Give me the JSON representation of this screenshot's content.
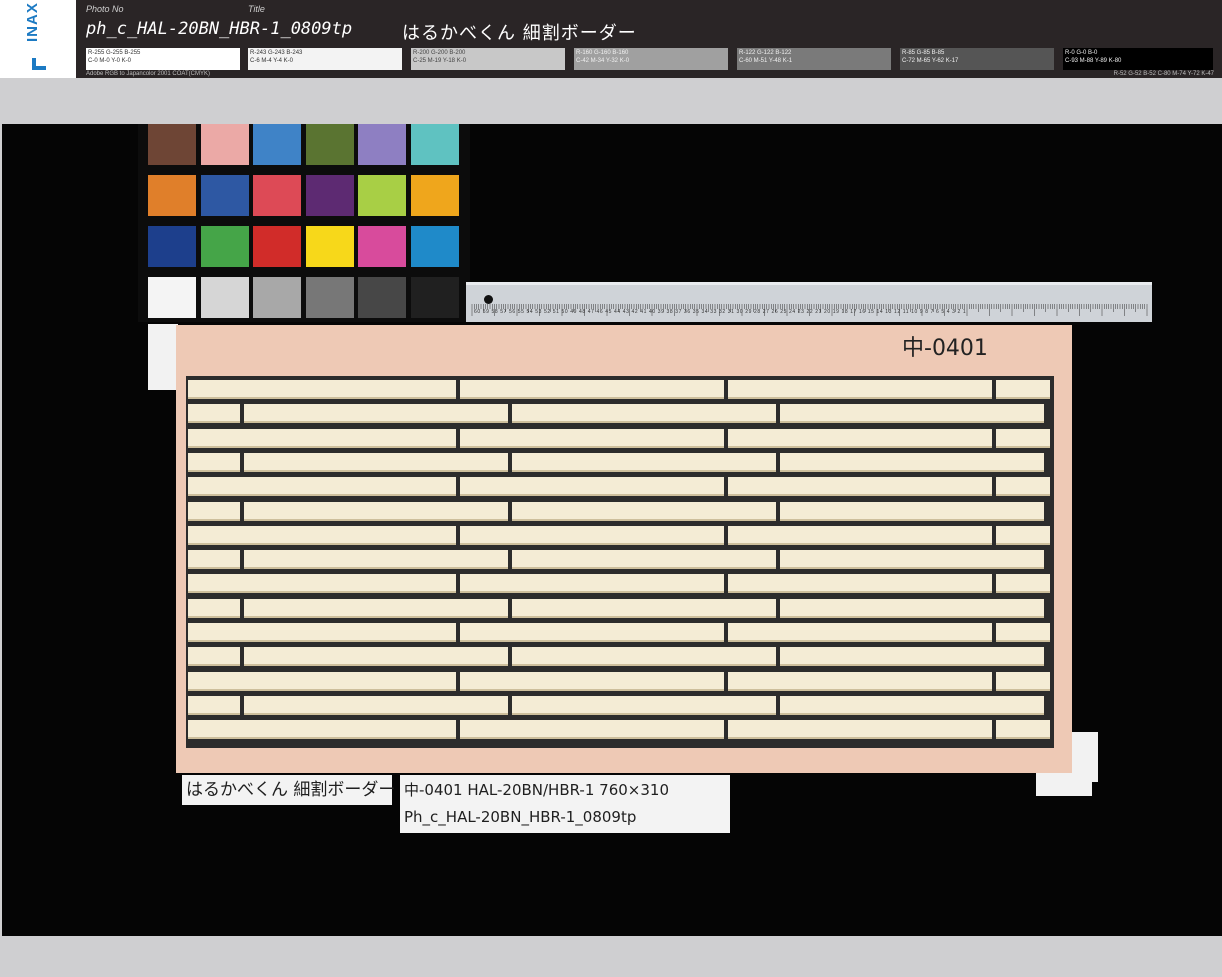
{
  "header": {
    "logo": "INAX",
    "photo_no_label": "Photo No",
    "photo_no": "ph_c_HAL-20BN_HBR-1_0809tp",
    "title_label": "Title",
    "title": "はるかべくん 細割ボーダー",
    "swatches": [
      {
        "bg": "#ffffff",
        "fg": "#333333",
        "line1": "R-255 G-255 B-255",
        "line2": "C-0 M-0 Y-0 K-0"
      },
      {
        "bg": "#f3f3f3",
        "fg": "#333333",
        "line1": "R-243 G-243 B-243",
        "line2": "C-6 M-4 Y-4 K-0"
      },
      {
        "bg": "#c8c8c8",
        "fg": "#444444",
        "line1": "R-200 G-200 B-200",
        "line2": "C-25 M-19 Y-18 K-0"
      },
      {
        "bg": "#a0a0a0",
        "fg": "#f0f0f0",
        "line1": "R-160 G-160 B-160",
        "line2": "C-42 M-34 Y-32 K-0"
      },
      {
        "bg": "#7a7a7a",
        "fg": "#f0f0f0",
        "line1": "R-122 G-122 B-122",
        "line2": "C-60 M-51 Y-48 K-1"
      },
      {
        "bg": "#555555",
        "fg": "#f0f0f0",
        "line1": "R-85 G-85 B-85",
        "line2": "C-72 M-65 Y-62 K-17"
      },
      {
        "bg": "#000000",
        "fg": "#f0f0f0",
        "line1": "R-0 G-0 B-0",
        "line2": "C-93 M-88 Y-89 K-80"
      }
    ],
    "footer_left": "Adobe RGB to Japancolor 2001 COAT(CMYK)",
    "footer_right": "R-52 G-52 B-52   C-80 M-74 Y-72 K-47"
  },
  "photo": {
    "board_mark": "中-0401",
    "label_left": "はるかべくん 細割ボーダー",
    "label_right_line1": "中-0401 HAL-20BN/HBR-1   760×310",
    "label_right_line2": "Ph_c_HAL-20BN_HBR-1_0809tp",
    "color_checker": [
      "#6e4535",
      "#eba9a6",
      "#3f83c7",
      "#5a7431",
      "#8e7fc2",
      "#5fc2c1",
      "#e07f2a",
      "#2e58a3",
      "#dd4a56",
      "#5d2a72",
      "#a8cf45",
      "#efa61c",
      "#1d3f8c",
      "#45a548",
      "#d12c29",
      "#f7d81a",
      "#d84b9c",
      "#1f8ac9",
      "#f4f4f4",
      "#d6d6d6",
      "#a8a8a8",
      "#777777",
      "#474747",
      "#202020"
    ],
    "ruler_numbers": "60 59 58 57 56 55 54 53 52 51 50 49 48 47 46 45 44 43 42 41 40 39 38 37 36 35 34 33 32 31 30 29 28 27 26 25 24 23 22 21 20 19 18 17 16 15 14 13 12 11 10 9 8 7 6 5 4 3 2 1"
  }
}
